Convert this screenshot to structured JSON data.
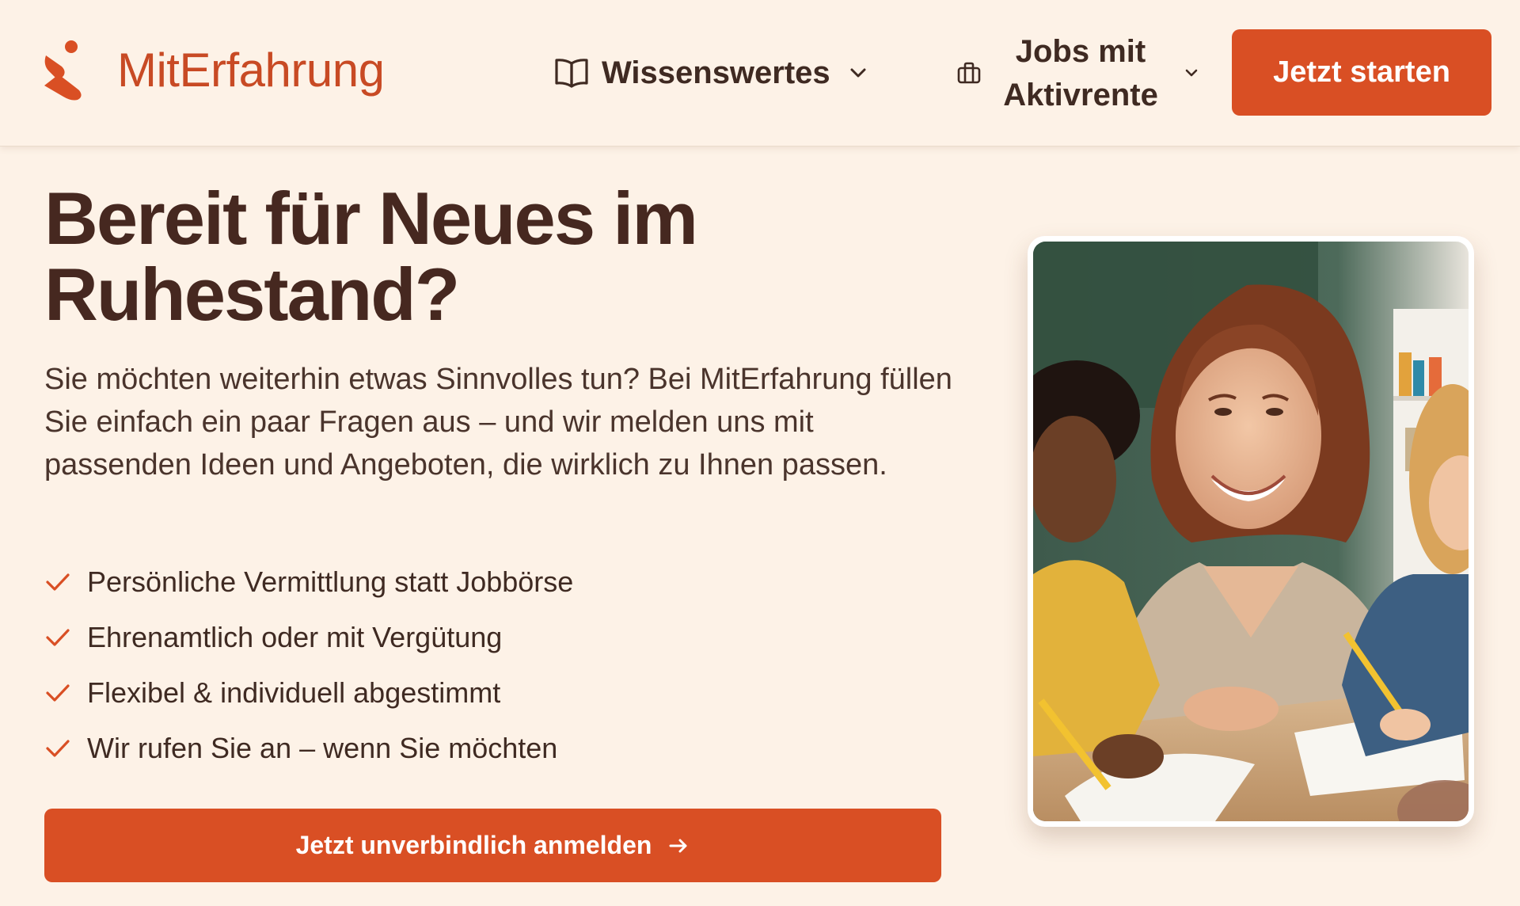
{
  "header": {
    "brand": "MitErfahrung",
    "nav": [
      {
        "label": "Wissenswertes",
        "icon": "book-icon"
      },
      {
        "label": "Jobs mit Aktivrente",
        "icon": "briefcase-icon"
      }
    ],
    "cta_label": "Jetzt starten"
  },
  "hero": {
    "title": "Bereit für Neues im Ruhestand?",
    "description": "Sie möchten weiterhin etwas Sinnvolles tun? Bei MitErfahrung füllen Sie einfach ein paar Fragen aus – und wir melden uns mit passenden Ideen und Angeboten, die wirklich zu Ihnen passen.",
    "features": [
      "Persönliche Vermittlung statt Jobbörse",
      "Ehrenamtlich oder mit Vergütung",
      "Flexibel & individuell abgestimmt",
      "Wir rufen Sie an – wenn Sie möchten"
    ],
    "register_label": "Jetzt unverbindlich anmelden"
  },
  "colors": {
    "background": "#fdf2e7",
    "accent": "#d94f24",
    "brand_text": "#c84a24",
    "heading": "#462820"
  }
}
